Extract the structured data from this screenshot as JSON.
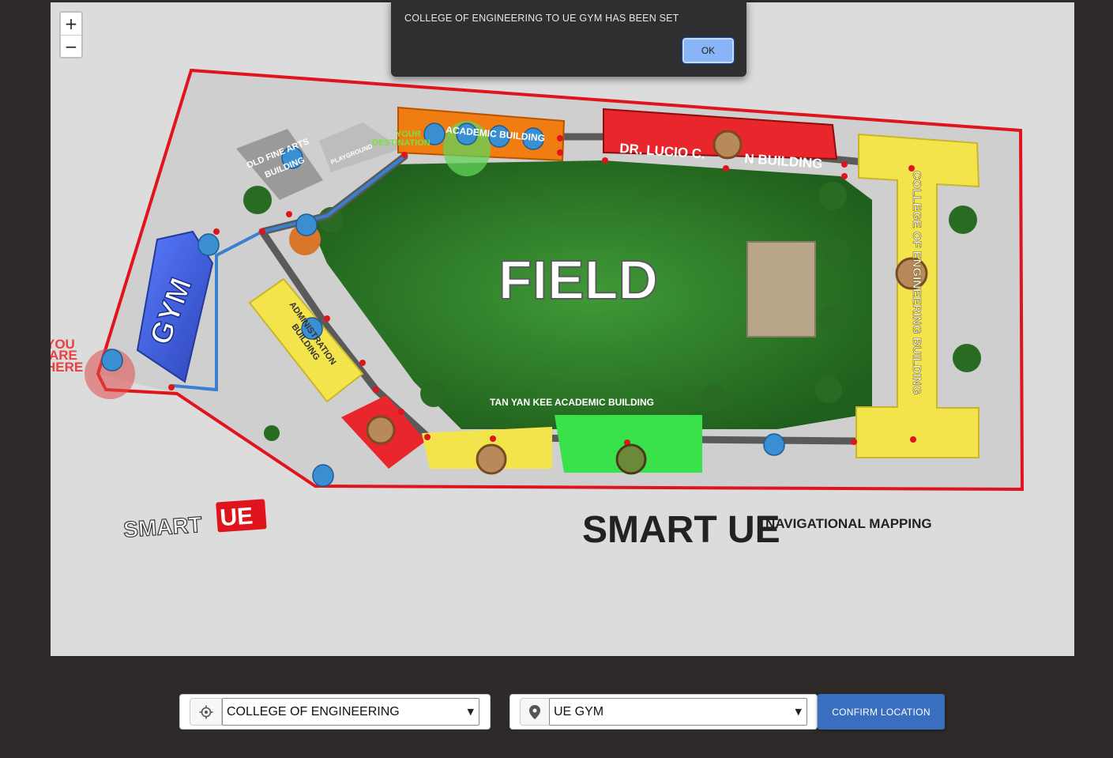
{
  "dialog": {
    "message": "COLLEGE OF ENGINEERING TO UE GYM HAS BEEN SET",
    "ok_label": "OK"
  },
  "zoom": {
    "in_label": "+",
    "out_label": "−"
  },
  "map": {
    "labels": {
      "field": "FIELD",
      "gym": "GYM",
      "lucio": "DR. LUCIO C.",
      "lucio_tail": "N BUILDING",
      "engineering": "COLLEGE OF ENGINEERING BUILDING",
      "tan_yan_kee": "TAN YAN KEE ACADEMIC BUILDING",
      "old_fine_arts_1": "OLD FINE ARTS",
      "old_fine_arts_2": "BUILDING",
      "playground": "PLAYGROUND",
      "admin_1": "ADMINISTRATION",
      "admin_2": "BUILDING",
      "academic": "ACADEMIC BUILDING",
      "your_destination_1": "YOUR",
      "your_destination_2": "DESTINATION",
      "you_are_here_1": "YOU",
      "you_are_here_2": "ARE",
      "you_are_here_3": "HERE",
      "smart": "SMART",
      "ue": "UE",
      "title": "SMART UE",
      "subtitle": "NAVIGATIONAL MAPPING"
    },
    "colors": {
      "boundary": "#e0141c",
      "field": "#2f7d2a",
      "gym": "#3b5fe0",
      "yellow_building": "#f4e44c",
      "red_building": "#e8262b",
      "orange_building": "#f07d12",
      "green_building": "#39e24a",
      "route": "#3a7fd0",
      "pin": "#3a8fd2"
    }
  },
  "form": {
    "origin": {
      "icon": "crosshair-icon",
      "selected": "COLLEGE OF ENGINEERING"
    },
    "destination": {
      "icon": "map-marker-icon",
      "selected": "UE GYM"
    },
    "confirm_label": "CONFIRM LOCATION"
  }
}
